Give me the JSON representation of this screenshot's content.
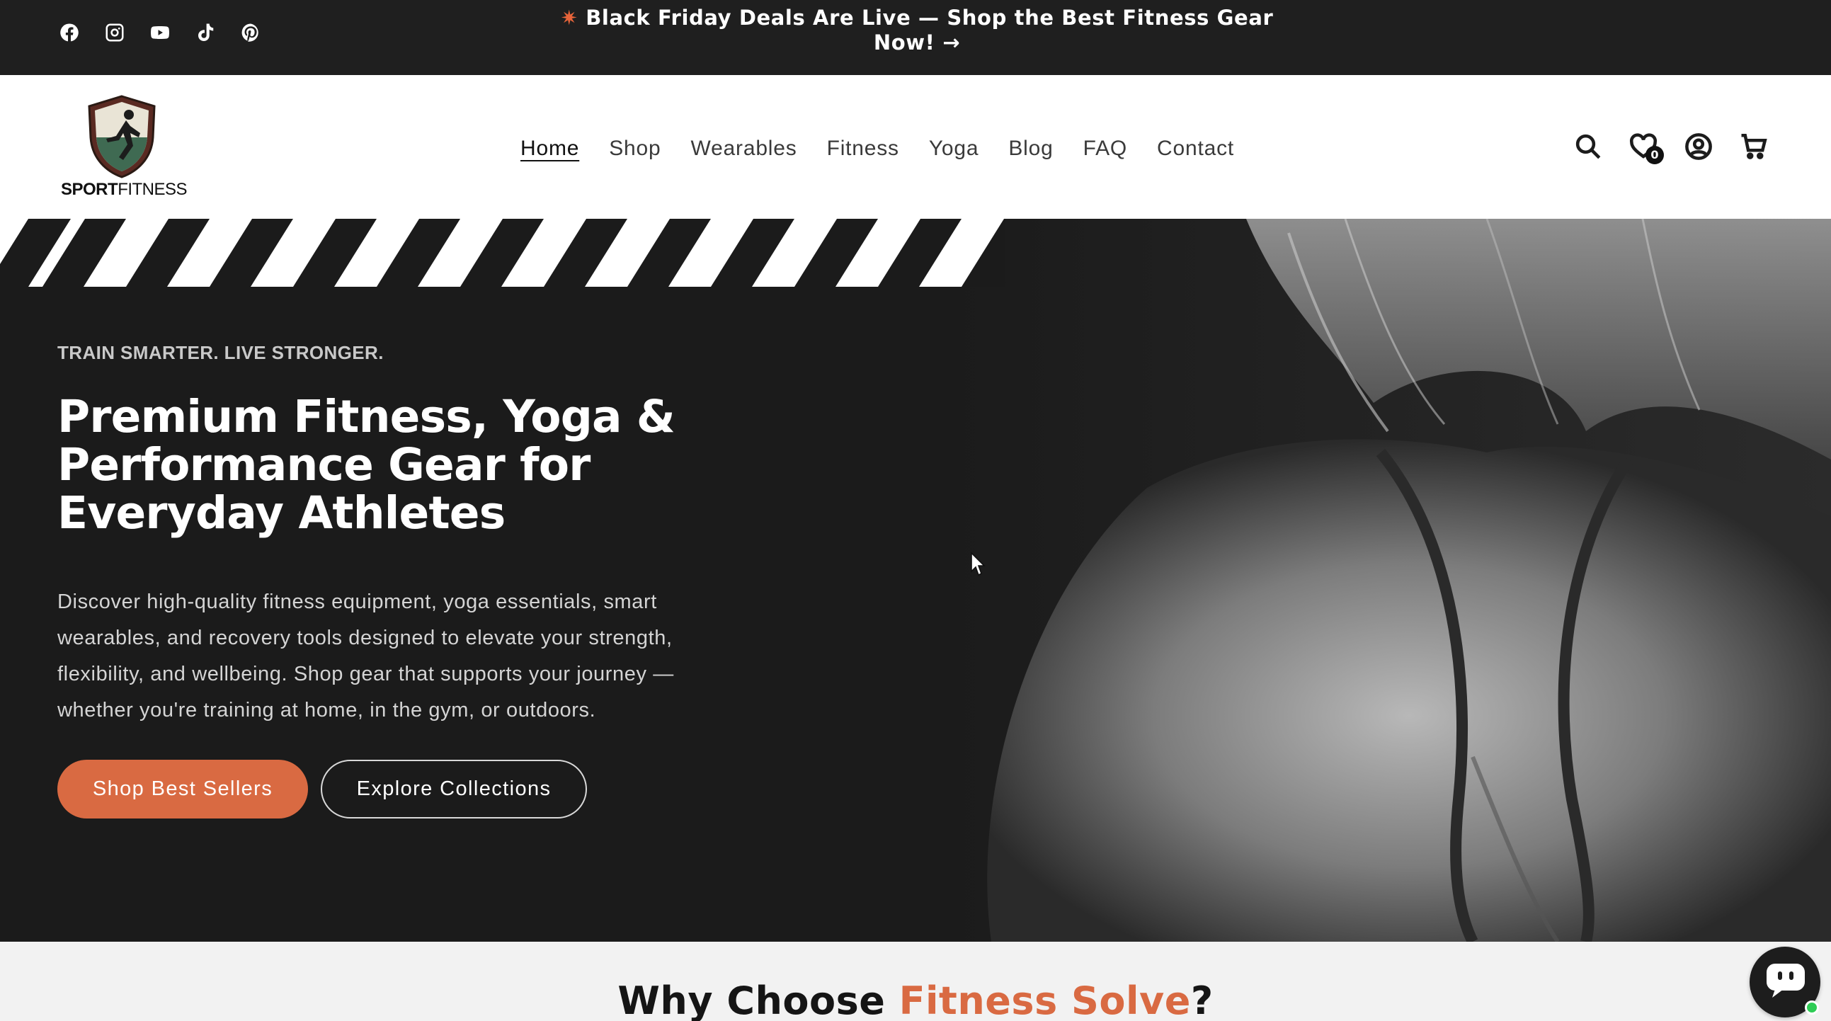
{
  "announcement": {
    "text": "Black Friday Deals Are Live — Shop the Best Fitness Gear Now! →",
    "social_icons": [
      "facebook-icon",
      "instagram-icon",
      "youtube-icon",
      "tiktok-icon",
      "pinterest-icon"
    ]
  },
  "header": {
    "logo_text_bold": "SPORT",
    "logo_text_light": "FITNESS",
    "nav": [
      {
        "label": "Home",
        "active": true
      },
      {
        "label": "Shop"
      },
      {
        "label": "Wearables"
      },
      {
        "label": "Fitness"
      },
      {
        "label": "Yoga"
      },
      {
        "label": "Blog"
      },
      {
        "label": "FAQ"
      },
      {
        "label": "Contact"
      }
    ],
    "wishlist_count": "0",
    "icons": [
      "search-icon",
      "wishlist-heart-icon",
      "account-icon",
      "cart-icon"
    ]
  },
  "hero": {
    "eyebrow": "TRAIN SMARTER. LIVE STRONGER.",
    "title": "Premium Fitness, Yoga & Performance Gear for Everyday Athletes",
    "description": "Discover high-quality fitness equipment, yoga essentials, smart wearables, and recovery tools designed to elevate your strength, flexibility, and wellbeing. Shop gear that supports your journey — whether you're training at home, in the gym, or outdoors.",
    "primary_button": "Shop Best Sellers",
    "secondary_button": "Explore Collections"
  },
  "why": {
    "title_before": "Why Choose ",
    "title_accent": "Fitness Solve",
    "title_after": "?"
  },
  "colors": {
    "accent": "#d96a42",
    "dark": "#1f1f1f",
    "online": "#2ecc55"
  }
}
